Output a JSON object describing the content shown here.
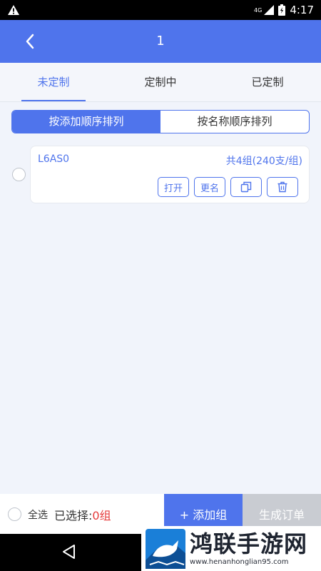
{
  "status_bar": {
    "network": "4G",
    "time": "4:17"
  },
  "header": {
    "title": "1"
  },
  "tabs": [
    {
      "label": "未定制",
      "active": true
    },
    {
      "label": "定制中",
      "active": false
    },
    {
      "label": "已定制",
      "active": false
    }
  ],
  "sort": {
    "by_add_order": "按添加顺序排列",
    "by_name_order": "按名称顺序排列",
    "active": "by_add_order"
  },
  "groups": [
    {
      "name": "L6AS0",
      "count": "共4组(240支/组)",
      "actions": {
        "open": "打开",
        "rename": "更名"
      }
    }
  ],
  "bottom": {
    "select_all": "全选",
    "selected_label": "已选择:",
    "selected_count": "0组",
    "add_group": "+ 添加组",
    "generate_order": "生成订单"
  },
  "watermark": {
    "title": "鸿联手游网",
    "url": "www.henanhonglian95.com"
  },
  "colors": {
    "primary": "#4f74ec",
    "danger": "#e53b3b",
    "disabled": "#c9ccd2"
  }
}
